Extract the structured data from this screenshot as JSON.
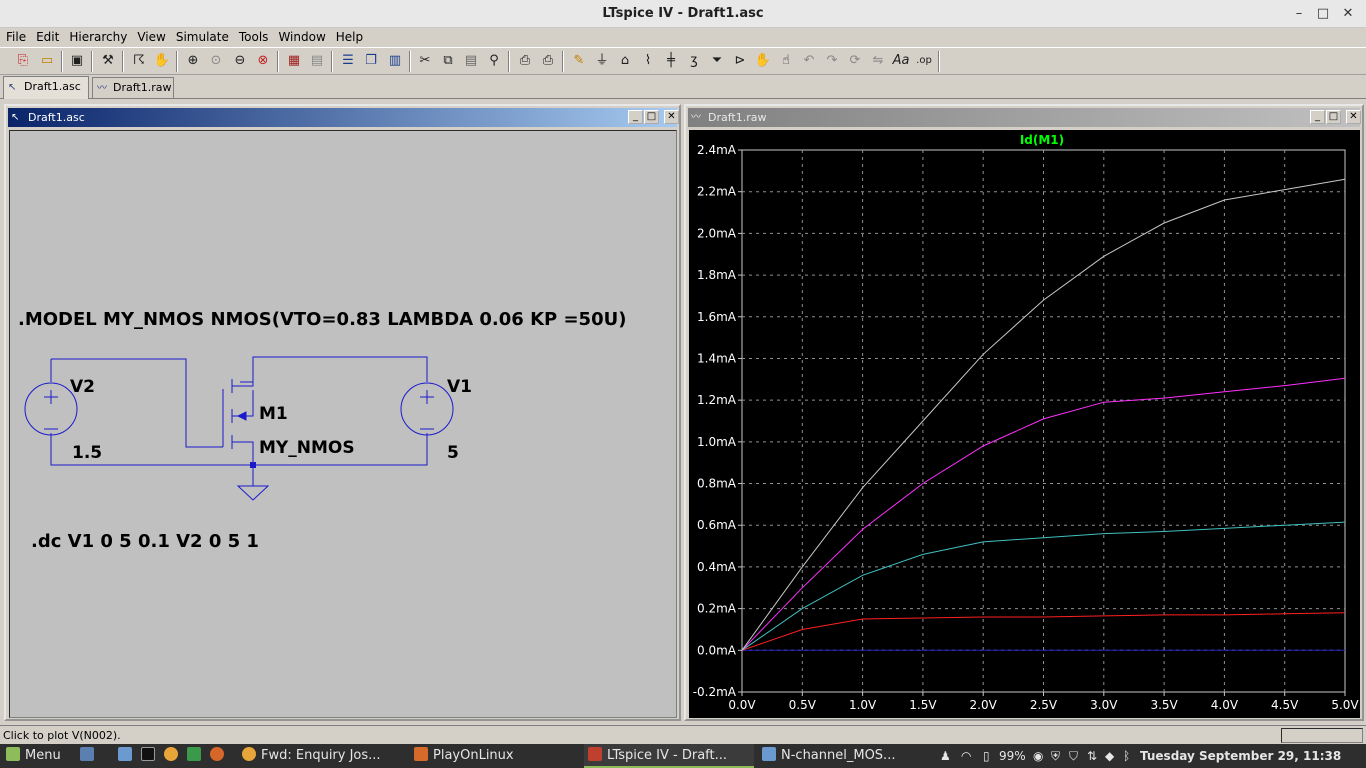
{
  "window": {
    "title": "LTspice IV - Draft1.asc"
  },
  "menu": [
    "File",
    "Edit",
    "Hierarchy",
    "View",
    "Simulate",
    "Tools",
    "Window",
    "Help"
  ],
  "toolbar_icons": [
    "new-schematic-icon",
    "open-icon",
    "save-icon",
    "control-panel-icon",
    "run-icon",
    "halt-icon",
    "zoom-in-icon",
    "zoom-pan-icon",
    "zoom-out-icon",
    "zoom-cancel-icon",
    "autorange-icon",
    "grid-icon",
    "tile-horizontal-icon",
    "cascade-icon",
    "tile-vertical-icon",
    "cut-icon",
    "copy-icon",
    "paste-icon",
    "find-icon",
    "print-setup-icon",
    "print-icon",
    "draw-wire-icon",
    "ground-icon",
    "label-net-icon",
    "resistor-icon",
    "capacitor-icon",
    "inductor-icon",
    "diode-icon",
    "component-icon",
    "move-icon",
    "drag-icon",
    "undo-icon",
    "redo-icon",
    "rotate-icon",
    "mirror-icon",
    "text-icon",
    "spice-directive-icon"
  ],
  "tabs": [
    {
      "label": "Draft1.asc",
      "icon": "schematic-icon",
      "active": true
    },
    {
      "label": "Draft1.raw",
      "icon": "waveform-icon",
      "active": false
    }
  ],
  "schematic": {
    "title": "Draft1.asc",
    "model_directive": ".MODEL MY_NMOS NMOS(VTO=0.83 LAMBDA 0.06 KP =50U)",
    "dc_directive": ".dc V1 0 5 0.1 V2 0 5 1",
    "v2_name": "V2",
    "v2_value": "1.5",
    "v1_name": "V1",
    "v1_value": "5",
    "m1_name": "M1",
    "m1_model": "MY_NMOS"
  },
  "plot": {
    "title": "Draft1.raw",
    "trace_label": "Id(M1)",
    "trace_label_color": "#00ff00"
  },
  "chart_data": {
    "type": "line",
    "title": "Id(M1)",
    "xlabel": "",
    "ylabel": "",
    "x_unit": "V",
    "y_unit": "mA",
    "xlim": [
      0,
      5
    ],
    "ylim": [
      -0.2,
      2.4
    ],
    "x_ticks": [
      "0.0V",
      "0.5V",
      "1.0V",
      "1.5V",
      "2.0V",
      "2.5V",
      "3.0V",
      "3.5V",
      "4.0V",
      "4.5V",
      "5.0V"
    ],
    "y_ticks": [
      "-0.2mA",
      "0.0mA",
      "0.2mA",
      "0.4mA",
      "0.6mA",
      "0.8mA",
      "1.0mA",
      "1.2mA",
      "1.4mA",
      "1.6mA",
      "1.8mA",
      "2.0mA",
      "2.2mA",
      "2.4mA"
    ],
    "grid": true,
    "x": [
      0,
      0.5,
      1.0,
      1.5,
      2.0,
      2.5,
      3.0,
      3.5,
      4.0,
      4.5,
      5.0
    ],
    "series": [
      {
        "color": "#2020c0",
        "values": [
          0,
          0,
          0,
          0,
          0,
          0,
          0,
          0,
          0,
          0,
          0
        ]
      },
      {
        "color": "#ff2020",
        "values": [
          0,
          0.1,
          0.15,
          0.155,
          0.16,
          0.16,
          0.165,
          0.17,
          0.17,
          0.175,
          0.18
        ]
      },
      {
        "color": "#40c0c0",
        "values": [
          0,
          0.2,
          0.36,
          0.46,
          0.52,
          0.54,
          0.56,
          0.57,
          0.585,
          0.6,
          0.615
        ]
      },
      {
        "color": "#ff30ff",
        "values": [
          0,
          0.3,
          0.58,
          0.8,
          0.98,
          1.11,
          1.19,
          1.21,
          1.24,
          1.27,
          1.305
        ]
      },
      {
        "color": "#c8c8c8",
        "values": [
          0,
          0.4,
          0.78,
          1.1,
          1.42,
          1.68,
          1.89,
          2.05,
          2.16,
          2.21,
          2.26
        ]
      }
    ]
  },
  "status": {
    "text": "Click to plot V(N002)."
  },
  "taskbar": {
    "menu_label": "Menu",
    "items": [
      {
        "label": "Fwd: Enquiry Jos...",
        "icon": "chrome-icon",
        "color": "#e8a53a"
      },
      {
        "label": "PlayOnLinux",
        "icon": "playonlinux-icon",
        "color": "#d66a2a"
      },
      {
        "label": "LTspice IV - Draft...",
        "icon": "ltspice-icon",
        "color": "#c04030",
        "active": true
      },
      {
        "label": "N-channel_MOS...",
        "icon": "folder-icon",
        "color": "#6a9ad0"
      }
    ],
    "battery": "99%",
    "clock": "Tuesday September 29, 11:38"
  }
}
